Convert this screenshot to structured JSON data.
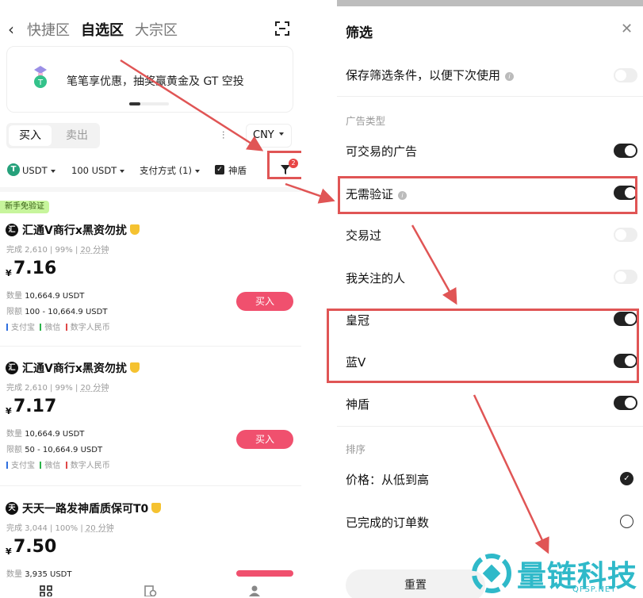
{
  "left": {
    "tabs": [
      "快捷区",
      "自选区",
      "大宗区"
    ],
    "active_tab": "自选区",
    "banner_text": "笔笔享优惠，抽奖赢黄金及 GT 空投",
    "segment": {
      "buy": "买入",
      "sell": "卖出"
    },
    "currency": "CNY",
    "filters": {
      "asset": "USDT",
      "amount": "100 USDT",
      "payment": "支付方式 (1)",
      "shield_label": "神盾",
      "filter_badge": "2"
    },
    "new_tag": "新手免验证",
    "merchants": [
      {
        "avatar": "汇",
        "name": "汇通V商行x黑资勿扰",
        "completed": "完成 2,610",
        "rate": "99%",
        "time": "20 分钟",
        "yen": "¥",
        "price": "7.16",
        "qty_label": "数量",
        "qty": "10,664.9 USDT",
        "limit_label": "限额",
        "limit": "100 - 10,664.9 USDT",
        "payments": [
          "支付宝",
          "微信",
          "数字人民币"
        ],
        "buy_label": "买入"
      },
      {
        "avatar": "汇",
        "name": "汇通V商行x黑资勿扰",
        "completed": "完成 2,610",
        "rate": "99%",
        "time": "20 分钟",
        "yen": "¥",
        "price": "7.17",
        "qty_label": "数量",
        "qty": "10,664.9 USDT",
        "limit_label": "限额",
        "limit": "50 - 10,664.9 USDT",
        "payments": [
          "支付宝",
          "微信",
          "数字人民币"
        ],
        "buy_label": "买入"
      },
      {
        "avatar": "天",
        "name": "天天一路发神盾质保可T0",
        "completed": "完成 3,044",
        "rate": "100%",
        "time": "20 分钟",
        "yen": "¥",
        "price": "7.50",
        "qty_label": "数量",
        "qty": "3,935 USDT"
      }
    ],
    "payment_colors": [
      "#2f6fdf",
      "#2bb34a",
      "#e04848"
    ]
  },
  "right": {
    "title": "筛选",
    "save_label": "保存筛选条件，以便下次使用",
    "ad_type_section": "广告类型",
    "options": [
      {
        "label": "可交易的广告",
        "on": true
      },
      {
        "label": "无需验证",
        "on": true,
        "info": true
      },
      {
        "label": "交易过",
        "on": false
      },
      {
        "label": "我关注的人",
        "on": false
      },
      {
        "label": "皇冠",
        "on": true
      },
      {
        "label": "蓝V",
        "on": true
      },
      {
        "label": "神盾",
        "on": true
      }
    ],
    "sort_section": "排序",
    "sort_options": [
      {
        "label": "价格：从低到高",
        "selected": true
      },
      {
        "label": "已完成的订单数",
        "selected": false
      }
    ],
    "reset_label": "重置"
  },
  "watermark": {
    "text": "量链科技",
    "sub": "QFSP.NET"
  },
  "colors": {
    "highlight": "#e05555",
    "buy": "#f0506e",
    "toggle_on": "#222222",
    "watermark": "#2fb9c9"
  }
}
